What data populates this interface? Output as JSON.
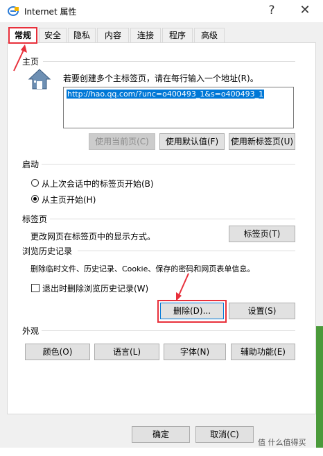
{
  "window": {
    "title": "Internet 属性",
    "help": "?",
    "close": "✕"
  },
  "tabs": [
    "常规",
    "安全",
    "隐私",
    "内容",
    "连接",
    "程序",
    "高级"
  ],
  "homepage": {
    "section": "主页",
    "instruction": "若要创建多个主标签页，请在每行输入一个地址(R)。",
    "url": "http://hao.qq.com/?unc=o400493_1&s=o400493_1",
    "buttons": [
      "使用当前页(C)",
      "使用默认值(F)",
      "使用新标签页(U)"
    ]
  },
  "startup": {
    "section": "启动",
    "options": [
      "从上次会话中的标签页开始(B)",
      "从主页开始(H)"
    ]
  },
  "tabsection": {
    "section": "标签页",
    "desc": "更改网页在标签页中的显示方式。",
    "button": "标签页(T)"
  },
  "history": {
    "section": "浏览历史记录",
    "desc": "删除临时文件、历史记录、Cookie、保存的密码和网页表单信息。",
    "checkbox": "退出时删除浏览历史记录(W)",
    "delete": "删除(D)...",
    "settings": "设置(S)"
  },
  "appearance": {
    "section": "外观",
    "buttons": [
      "颜色(O)",
      "语言(L)",
      "字体(N)",
      "辅助功能(E)"
    ]
  },
  "footer": {
    "ok": "确定",
    "cancel": "取消(C)"
  },
  "watermark": "值 什么值得买",
  "colors": {
    "highlight": "#e8303b",
    "selection": "#0078d7"
  }
}
